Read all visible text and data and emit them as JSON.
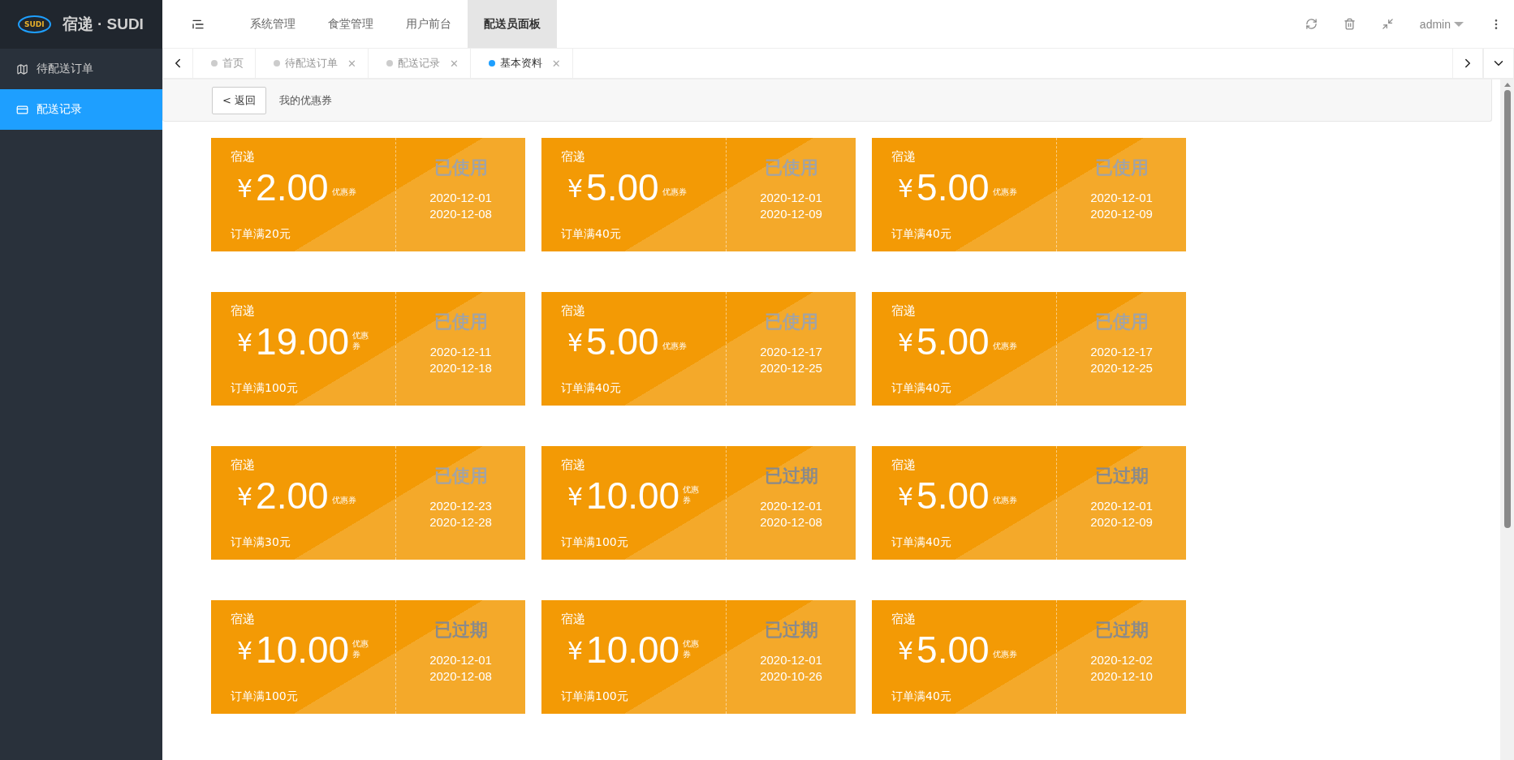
{
  "brand": {
    "logo": "SUDI",
    "title": "宿递 · SUDI"
  },
  "top_nav": [
    {
      "label": "系统管理",
      "selected": false
    },
    {
      "label": "食堂管理",
      "selected": false
    },
    {
      "label": "用户前台",
      "selected": false
    },
    {
      "label": "配送员面板",
      "selected": true
    }
  ],
  "user": {
    "name": "admin"
  },
  "sidebar": {
    "items": [
      {
        "label": "待配送订单",
        "selected": false
      },
      {
        "label": "配送记录",
        "selected": true
      }
    ]
  },
  "tabs": [
    {
      "label": "首页",
      "selected": false
    },
    {
      "label": "待配送订单",
      "close": "✕",
      "selected": false
    },
    {
      "label": "配送记录",
      "close": "✕",
      "selected": false
    },
    {
      "label": "基本资料",
      "close": "✕",
      "selected": true
    }
  ],
  "toolbar": {
    "back_button": "< 返回",
    "title": "我的优惠券"
  },
  "coupons": [
    {
      "brand": "宿递",
      "currency": "¥",
      "amount": "2.00",
      "unit": "优惠券",
      "condition": "订单满20元",
      "status": "已使用",
      "kind": "used",
      "start": "2020-12-01",
      "end": "2020-12-08"
    },
    {
      "brand": "宿递",
      "currency": "¥",
      "amount": "5.00",
      "unit": "优惠券",
      "condition": "订单满40元",
      "status": "已使用",
      "kind": "used",
      "start": "2020-12-01",
      "end": "2020-12-09"
    },
    {
      "brand": "宿递",
      "currency": "¥",
      "amount": "5.00",
      "unit": "优惠券",
      "condition": "订单满40元",
      "status": "已使用",
      "kind": "used",
      "start": "2020-12-01",
      "end": "2020-12-09"
    },
    {
      "brand": "宿递",
      "currency": "¥",
      "amount": "19.00",
      "unit": "优惠券",
      "condition": "订单满100元",
      "status": "已使用",
      "kind": "used",
      "start": "2020-12-11",
      "end": "2020-12-18"
    },
    {
      "brand": "宿递",
      "currency": "¥",
      "amount": "5.00",
      "unit": "优惠券",
      "condition": "订单满40元",
      "status": "已使用",
      "kind": "used",
      "start": "2020-12-17",
      "end": "2020-12-25"
    },
    {
      "brand": "宿递",
      "currency": "¥",
      "amount": "5.00",
      "unit": "优惠券",
      "condition": "订单满40元",
      "status": "已使用",
      "kind": "used",
      "start": "2020-12-17",
      "end": "2020-12-25"
    },
    {
      "brand": "宿递",
      "currency": "¥",
      "amount": "2.00",
      "unit": "优惠券",
      "condition": "订单满30元",
      "status": "已使用",
      "kind": "used",
      "start": "2020-12-23",
      "end": "2020-12-28"
    },
    {
      "brand": "宿递",
      "currency": "¥",
      "amount": "10.00",
      "unit": "优惠券",
      "condition": "订单满100元",
      "status": "已过期",
      "kind": "expired",
      "start": "2020-12-01",
      "end": "2020-12-08"
    },
    {
      "brand": "宿递",
      "currency": "¥",
      "amount": "5.00",
      "unit": "优惠券",
      "condition": "订单满40元",
      "status": "已过期",
      "kind": "expired",
      "start": "2020-12-01",
      "end": "2020-12-09"
    },
    {
      "brand": "宿递",
      "currency": "¥",
      "amount": "10.00",
      "unit": "优惠券",
      "condition": "订单满100元",
      "status": "已过期",
      "kind": "expired",
      "start": "2020-12-01",
      "end": "2020-12-08"
    },
    {
      "brand": "宿递",
      "currency": "¥",
      "amount": "10.00",
      "unit": "优惠券",
      "condition": "订单满100元",
      "status": "已过期",
      "kind": "expired",
      "start": "2020-12-01",
      "end": "2020-10-26"
    },
    {
      "brand": "宿递",
      "currency": "¥",
      "amount": "5.00",
      "unit": "优惠券",
      "condition": "订单满40元",
      "status": "已过期",
      "kind": "expired",
      "start": "2020-12-02",
      "end": "2020-12-10"
    }
  ]
}
